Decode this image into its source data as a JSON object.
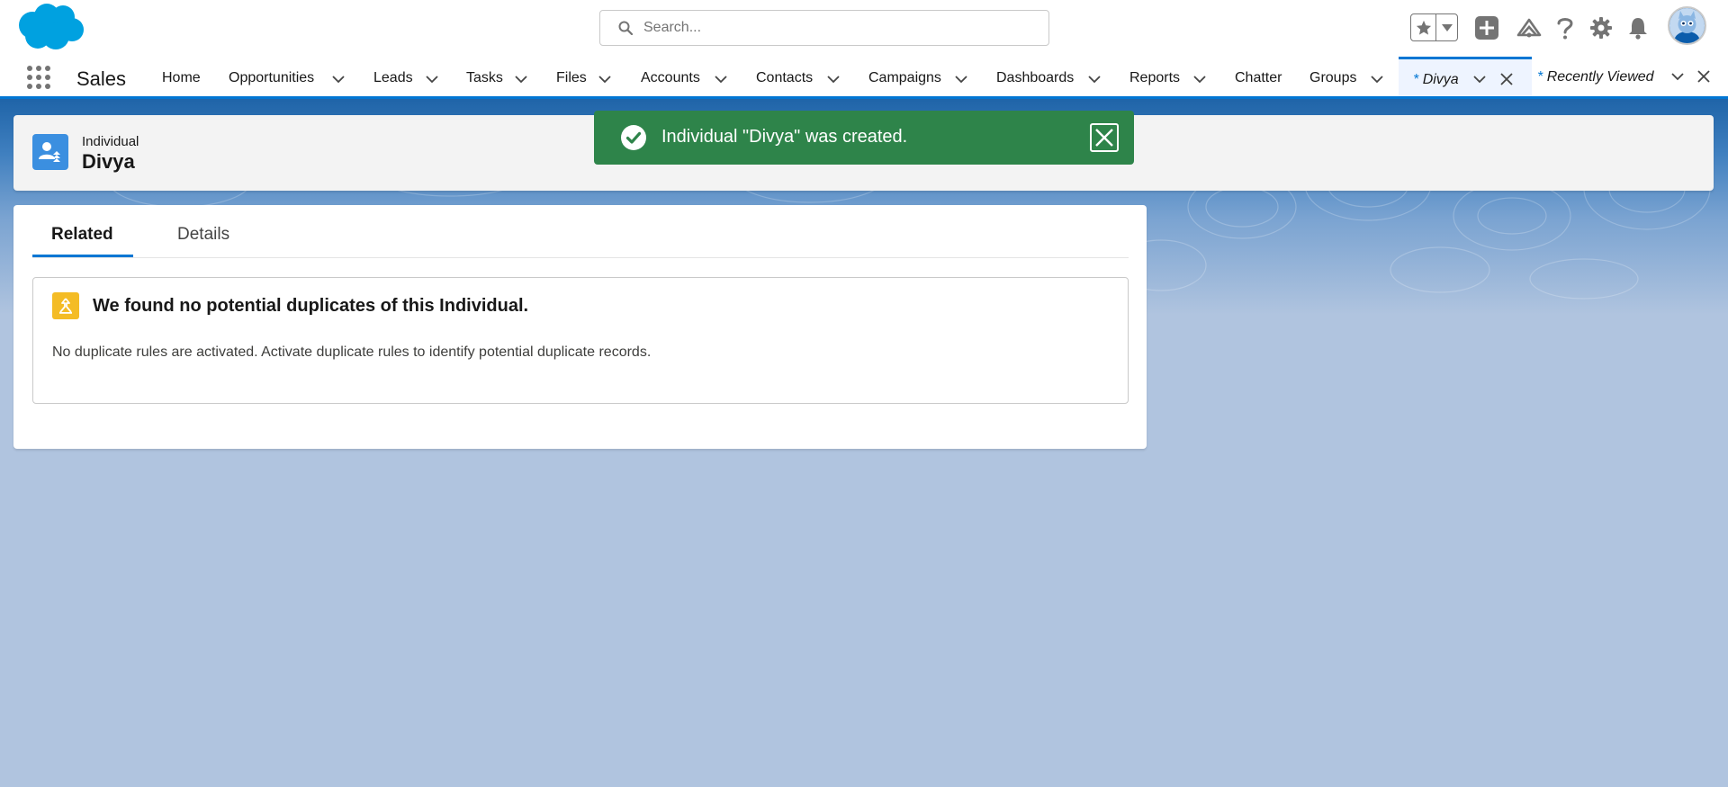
{
  "header": {
    "search_placeholder": "Search...",
    "icons": [
      "favorites-star-icon",
      "favorites-dropdown-icon",
      "add-icon",
      "trailhead-icon",
      "help-icon",
      "setup-gear-icon",
      "notifications-bell-icon",
      "avatar"
    ]
  },
  "nav": {
    "app_name": "Sales",
    "items": [
      {
        "label": "Home",
        "has_menu": false
      },
      {
        "label": "Opportunities",
        "has_menu": true
      },
      {
        "label": "Leads",
        "has_menu": true
      },
      {
        "label": "Tasks",
        "has_menu": true
      },
      {
        "label": "Files",
        "has_menu": true
      },
      {
        "label": "Accounts",
        "has_menu": true
      },
      {
        "label": "Contacts",
        "has_menu": true
      },
      {
        "label": "Campaigns",
        "has_menu": true
      },
      {
        "label": "Dashboards",
        "has_menu": true
      },
      {
        "label": "Reports",
        "has_menu": true
      },
      {
        "label": "Chatter",
        "has_menu": false
      },
      {
        "label": "Groups",
        "has_menu": true
      }
    ],
    "workspace_tabs": [
      {
        "marker": "*",
        "label": "Divya",
        "active": true
      },
      {
        "marker": "*",
        "label": "Recently Viewed",
        "active": false
      }
    ]
  },
  "record": {
    "type_label": "Individual",
    "name": "Divya"
  },
  "toast": {
    "message": "Individual \"Divya\" was created.",
    "variant": "success",
    "color": "#2e844a"
  },
  "tabs": [
    {
      "label": "Related",
      "active": true
    },
    {
      "label": "Details",
      "active": false
    }
  ],
  "duplicates": {
    "title": "We found no potential duplicates of this Individual.",
    "message": "No duplicate rules are activated. Activate duplicate rules to identify potential duplicate records."
  },
  "colors": {
    "brand": "#0176d3",
    "page_background": "#b0c4df",
    "record_icon": "#3b8fe0",
    "warning_icon": "#f4bc25"
  }
}
